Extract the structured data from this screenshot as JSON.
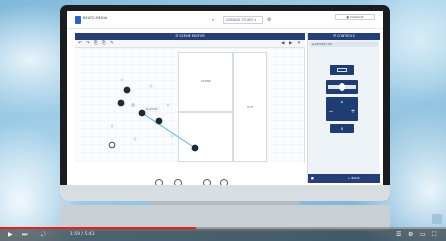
{
  "app": {
    "brand": "BEATS MEDIA",
    "select_a": "▾",
    "select_b": "SIGNAGE STUDIO  ▾",
    "account": "● SIGNAGE"
  },
  "canvas": {
    "header": "☰  SCENE EDITOR",
    "panel_label": "SCENE",
    "side_label": "OUT",
    "node_label": "PLAYLIST"
  },
  "toolbar": {
    "icons": [
      "↶",
      "↷",
      "⎘",
      "⎘",
      "✎",
      "◀",
      "▶",
      "✕"
    ]
  },
  "right_panel": {
    "header": "☰  CONTROLS",
    "tab": "◈ DEVICE LIST",
    "card_minus": "−",
    "card_plus": "+",
    "card_icon": "⌂",
    "footer_left": "■",
    "footer_right": "← BACK"
  },
  "player": {
    "progress_fraction": 0.44,
    "time": "1:59 / 5:43",
    "play": "▶",
    "next": "⏭",
    "volume": "🔊",
    "captions": "☰",
    "settings": "⚙",
    "theater": "▭",
    "fullscreen": "⛶"
  }
}
